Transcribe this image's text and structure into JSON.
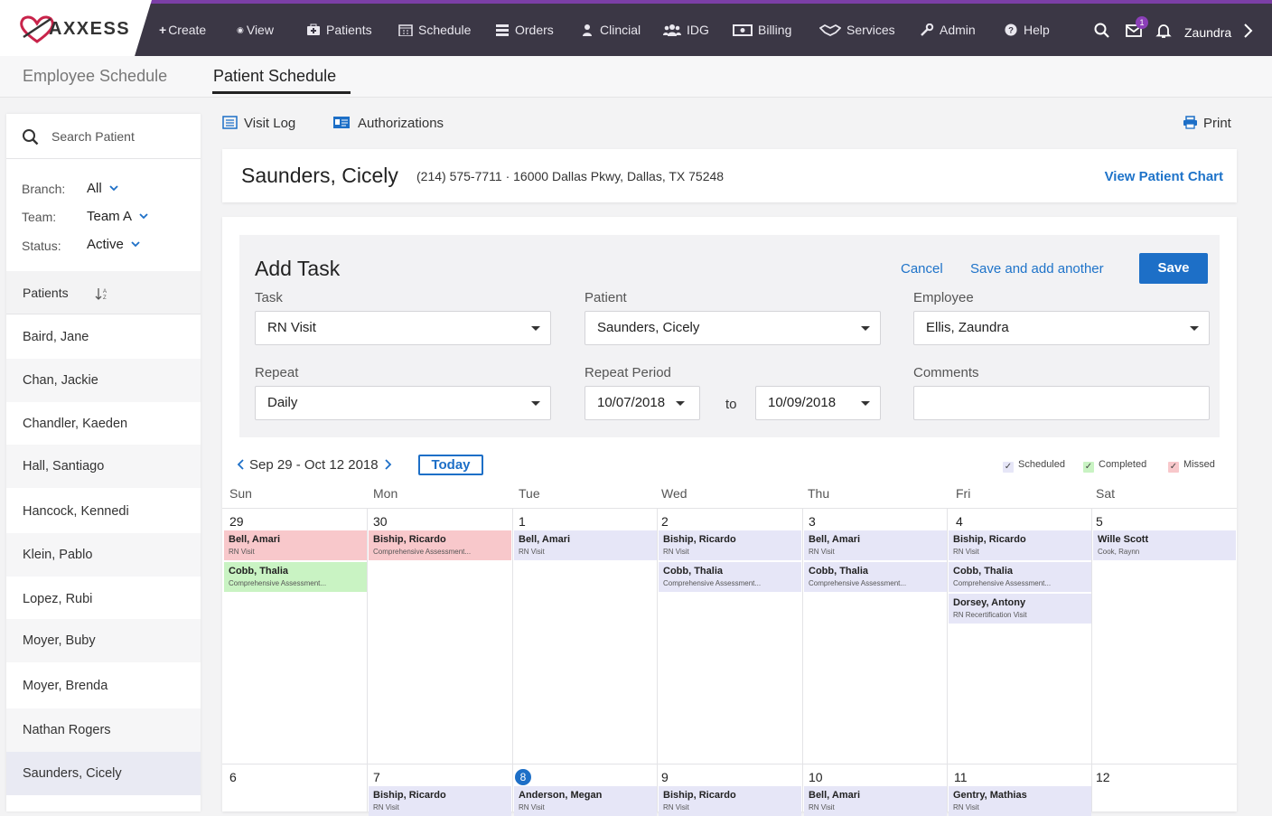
{
  "app": {
    "brand": "AXXESS",
    "accent": "#7b3fa6",
    "topbar_color": "#3b3745",
    "link_color": "#1e73c9"
  },
  "nav": {
    "create": "Create",
    "view": "View",
    "patients": "Patients",
    "schedule": "Schedule",
    "orders": "Orders",
    "clincial": "Clincial",
    "idg": "IDG",
    "billing": "Billing",
    "services": "Services",
    "admin": "Admin",
    "help": "Help",
    "notification_count": "1",
    "user": "Zaundra"
  },
  "tabs": {
    "employee": "Employee Schedule",
    "patient": "Patient Schedule"
  },
  "sidebar": {
    "search_placeholder": "Search Patient",
    "branch_label": "Branch:",
    "branch_value": "All",
    "team_label": "Team:",
    "team_value": "Team A",
    "status_label": "Status:",
    "status_value": "Active",
    "patients_header": "Patients",
    "patients": [
      "Baird, Jane",
      "Chan, Jackie",
      "Chandler, Kaeden",
      "Hall, Santiago",
      "Hancock, Kennedi",
      "Klein, Pablo",
      "Lopez, Rubi",
      "Moyer, Buby",
      "Moyer, Brenda",
      "Nathan Rogers",
      "Saunders, Cicely"
    ]
  },
  "toolbar": {
    "visit_log": "Visit Log",
    "authorizations": "Authorizations",
    "print": "Print"
  },
  "patient": {
    "name": "Saunders, Cicely",
    "info": "(214) 575-7711 · 16000 Dallas Pkwy, Dallas, TX 75248",
    "chart_link": "View Patient Chart"
  },
  "form": {
    "title": "Add Task",
    "cancel": "Cancel",
    "save_another": "Save and add another",
    "save": "Save",
    "task_label": "Task",
    "task_value": "RN Visit",
    "patient_label": "Patient",
    "patient_value": "Saunders, Cicely",
    "employee_label": "Employee",
    "employee_value": "Ellis, Zaundra",
    "repeat_label": "Repeat",
    "repeat_value": "Daily",
    "period_label": "Repeat Period",
    "period_from": "10/07/2018",
    "period_to_word": "to",
    "period_to": "10/09/2018",
    "comments_label": "Comments",
    "comments_value": ""
  },
  "calendar": {
    "range": "Sep 29 - Oct 12 2018",
    "today": "Today",
    "legend": {
      "scheduled": "Scheduled",
      "completed": "Completed",
      "missed": "Missed"
    },
    "days": [
      "Sun",
      "Mon",
      "Tue",
      "Wed",
      "Thu",
      "Fri",
      "Sat"
    ],
    "week1": [
      "29",
      "30",
      "1",
      "2",
      "3",
      "4",
      "5"
    ],
    "week2": [
      "6",
      "7",
      "8",
      "9",
      "10",
      "11",
      "12"
    ],
    "events_w1": [
      {
        "day": 0,
        "slot": 0,
        "name": "Bell, Amari",
        "task": "RN Visit",
        "status": "missed"
      },
      {
        "day": 0,
        "slot": 1,
        "name": "Cobb, Thalia",
        "task": "Comprehensive Assessment...",
        "status": "comp"
      },
      {
        "day": 1,
        "slot": 0,
        "name": "Biship, Ricardo",
        "task": "Comprehensive Assessment...",
        "status": "missed"
      },
      {
        "day": 2,
        "slot": 0,
        "name": "Bell, Amari",
        "task": "RN Visit",
        "status": "sched"
      },
      {
        "day": 3,
        "slot": 0,
        "name": "Biship, Ricardo",
        "task": "RN Visit",
        "status": "sched"
      },
      {
        "day": 3,
        "slot": 1,
        "name": "Cobb, Thalia",
        "task": "Comprehensive Assessment...",
        "status": "sched"
      },
      {
        "day": 4,
        "slot": 0,
        "name": "Bell, Amari",
        "task": "RN Visit",
        "status": "sched"
      },
      {
        "day": 4,
        "slot": 1,
        "name": "Cobb, Thalia",
        "task": "Comprehensive Assessment...",
        "status": "sched"
      },
      {
        "day": 5,
        "slot": 0,
        "name": "Biship, Ricardo",
        "task": "RN Visit",
        "status": "sched"
      },
      {
        "day": 5,
        "slot": 1,
        "name": "Cobb, Thalia",
        "task": "Comprehensive Assessment...",
        "status": "sched"
      },
      {
        "day": 5,
        "slot": 2,
        "name": "Dorsey, Antony",
        "task": "RN Recertification Visit",
        "status": "sched"
      },
      {
        "day": 6,
        "slot": 0,
        "name": "Wille Scott",
        "task": "Cook, Raynn",
        "status": "sched"
      }
    ],
    "events_w2": [
      {
        "day": 1,
        "slot": 0,
        "name": "Biship, Ricardo",
        "task": "RN Visit",
        "status": "sched"
      },
      {
        "day": 2,
        "slot": 0,
        "name": "Anderson, Megan",
        "task": "RN Visit",
        "status": "sched"
      },
      {
        "day": 3,
        "slot": 0,
        "name": "Biship, Ricardo",
        "task": "RN Visit",
        "status": "sched"
      },
      {
        "day": 4,
        "slot": 0,
        "name": "Bell, Amari",
        "task": "RN Visit",
        "status": "sched"
      },
      {
        "day": 5,
        "slot": 0,
        "name": "Gentry, Mathias",
        "task": "RN Visit",
        "status": "sched"
      }
    ]
  }
}
